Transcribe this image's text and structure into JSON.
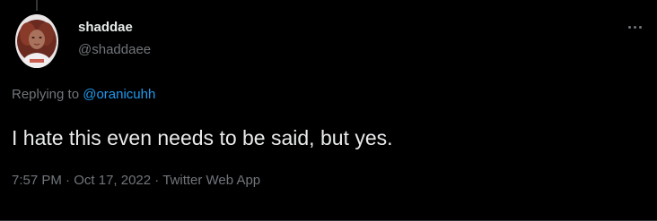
{
  "tweet": {
    "author": {
      "display_name": "shaddae",
      "handle": "@shaddaee",
      "avatar_icon": "profile-photo"
    },
    "reply_context": {
      "prefix": "Replying to ",
      "target": "@oranicuhh"
    },
    "text": "I hate this even needs to be said, but yes.",
    "time": "7:57 PM",
    "separator": " · ",
    "date": "Oct 17, 2022",
    "source": "Twitter Web App",
    "more_icon": "more-horizontal-icon"
  },
  "colors": {
    "background": "#000000",
    "primary_text": "#e7e9ea",
    "secondary_text": "#71767b",
    "link": "#1d9bf0",
    "divider": "#2f3336"
  }
}
